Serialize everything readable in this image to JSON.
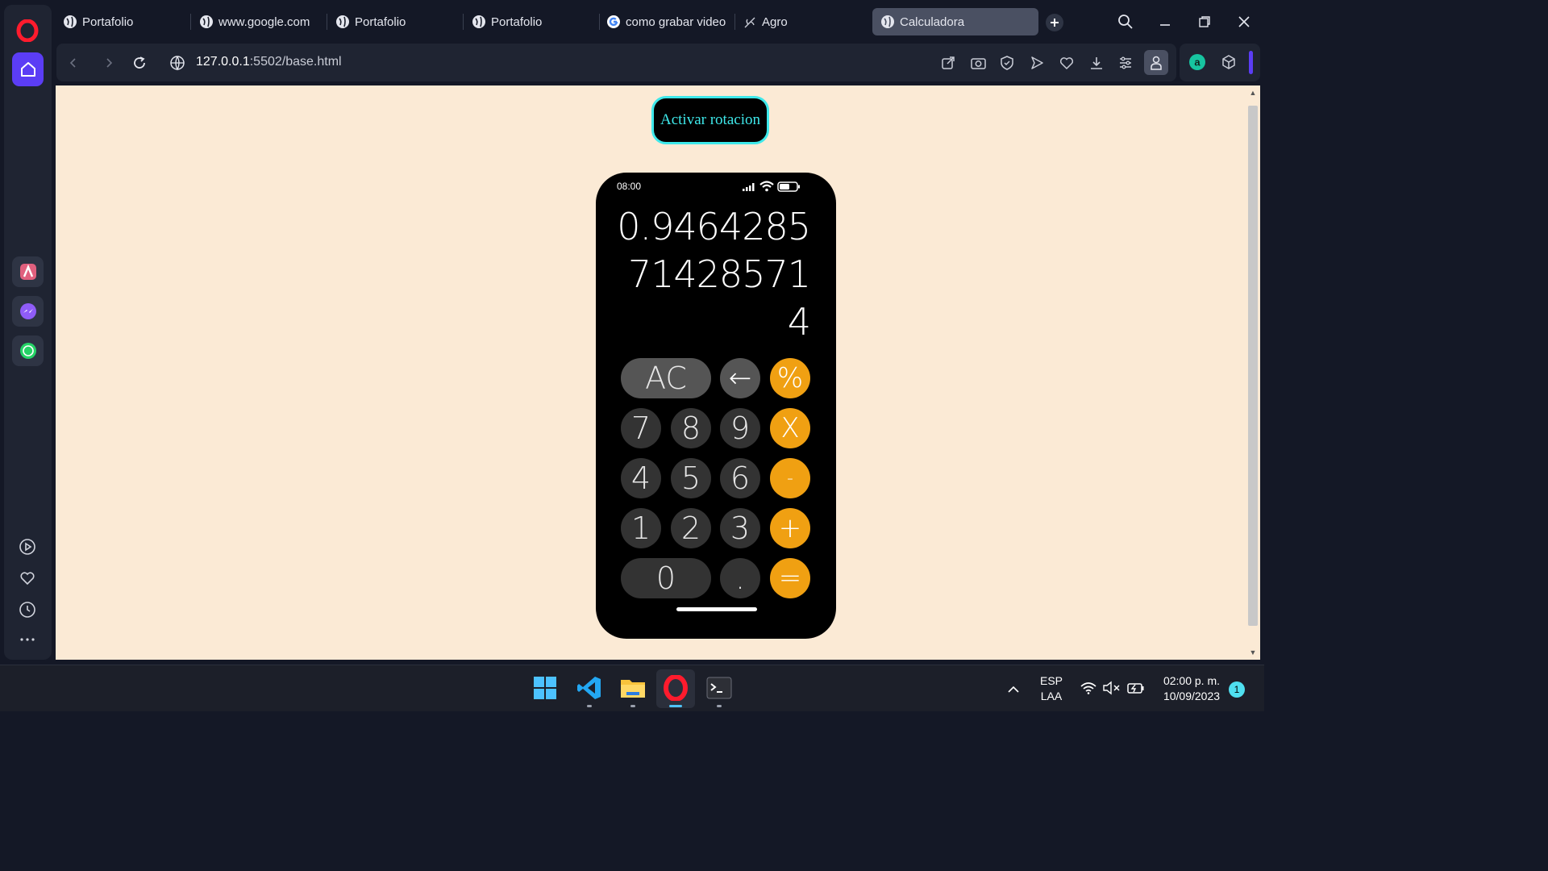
{
  "browser": {
    "tabs": [
      {
        "label": "Portafolio",
        "icon": "globe-icon"
      },
      {
        "label": "www.google.com",
        "icon": "globe-icon"
      },
      {
        "label": "Portafolio",
        "icon": "globe-icon"
      },
      {
        "label": "Portafolio",
        "icon": "globe-icon"
      },
      {
        "label": "como grabar video c",
        "icon": "google-icon"
      },
      {
        "label": "Agro",
        "icon": "plant-icon"
      },
      {
        "label": "Calculadora",
        "icon": "globe-icon",
        "active": true
      }
    ],
    "url_host": "127.0.0.1",
    "url_path": ":5502/base.html"
  },
  "page": {
    "rotate_button_label": "Activar rotacion",
    "phone": {
      "status_time": "08:00",
      "display_lines": [
        "0.9464285",
        "71428571",
        "4"
      ],
      "keys": {
        "ac": "AC",
        "back": "←",
        "percent": "%",
        "seven": "7",
        "eight": "8",
        "nine": "9",
        "times": "X",
        "four": "4",
        "five": "5",
        "six": "6",
        "minus": "-",
        "one": "1",
        "two": "2",
        "three": "3",
        "plus": "+",
        "zero": "0",
        "dot": ".",
        "equals": "="
      }
    }
  },
  "taskbar": {
    "lang": "ESP",
    "layout": "LAA",
    "time": "02:00 p. m.",
    "date": "10/09/2023",
    "notifications": "1"
  },
  "colors": {
    "accent": "#5b3df5",
    "page_bg": "#fbead5",
    "operator": "#f0a012",
    "rotate_button_border": "#3ee8ea"
  }
}
